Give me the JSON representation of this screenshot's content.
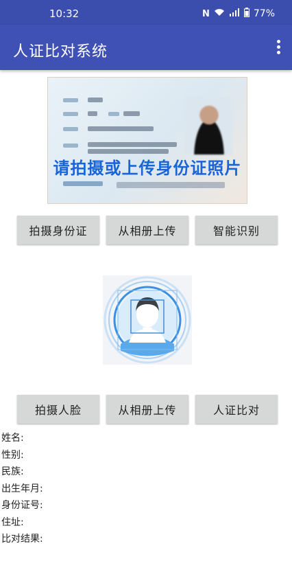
{
  "status_bar": {
    "time": "10:32",
    "battery": "77%",
    "icons": [
      "nfc-icon",
      "wifi-icon",
      "signal-5g-icon",
      "battery-icon"
    ]
  },
  "app_bar": {
    "title": "人证比对系统",
    "menu_icon": "more-vert-icon"
  },
  "id_card": {
    "hint": "请拍摄或上传身份证照片"
  },
  "id_buttons": {
    "capture": "拍摄身份证",
    "upload": "从相册上传",
    "recognize": "智能识别"
  },
  "face_buttons": {
    "capture": "拍摄人脸",
    "upload": "从相册上传",
    "compare": "人证比对"
  },
  "info": {
    "name": "姓名:",
    "gender": "性别:",
    "ethnicity": "民族:",
    "birth": "出生年月:",
    "id_number": "身份证号:",
    "address": "住址:",
    "result": "比对结果:"
  },
  "colors": {
    "status_bar": "#3b4dad",
    "app_bar": "#3f51b5",
    "button": "#d6d7d7",
    "hint_text": "#1a65d6"
  }
}
